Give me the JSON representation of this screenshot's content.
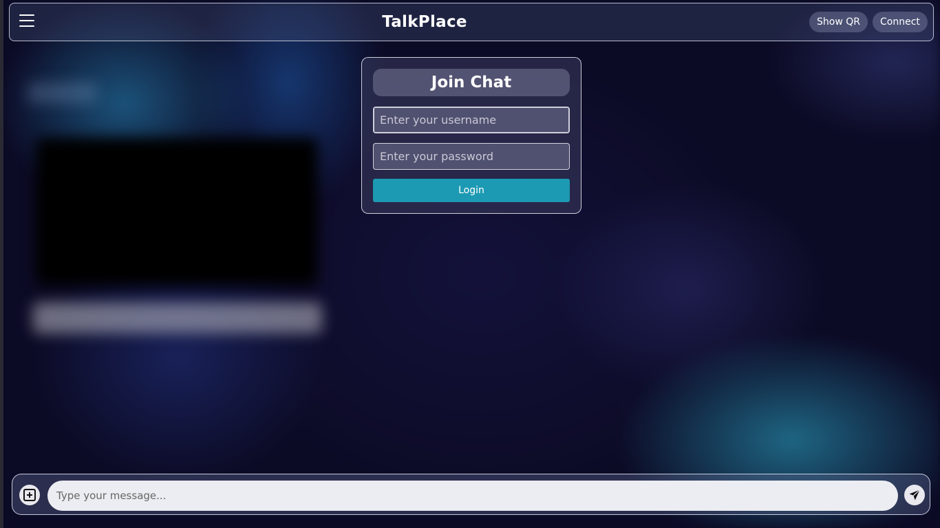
{
  "app": {
    "title": "TalkPlace"
  },
  "header": {
    "menu_icon": "hamburger-menu-icon",
    "show_qr_label": "Show QR",
    "connect_label": "Connect"
  },
  "login": {
    "title": "Join Chat",
    "username_placeholder": "Enter your username",
    "username_value": "",
    "password_placeholder": "Enter your password",
    "password_value": "",
    "login_label": "Login",
    "login_color": "#1d9ab3"
  },
  "composer": {
    "attach_icon": "plus-square-icon",
    "message_placeholder": "Type your message...",
    "message_value": "",
    "send_icon": "paper-plane-icon"
  }
}
